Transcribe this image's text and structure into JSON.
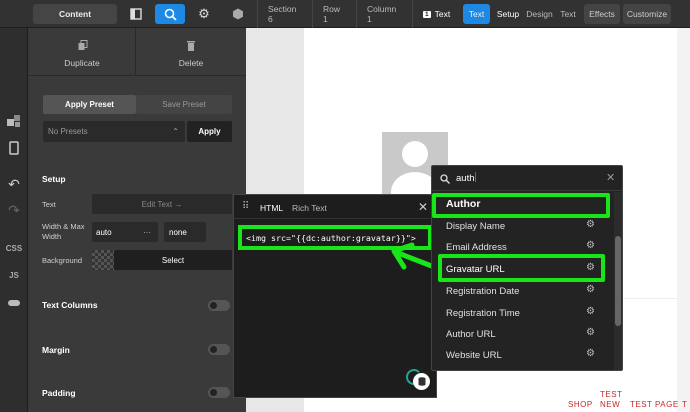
{
  "toolbar": {
    "content_label": "Content",
    "breadcrumbs": [
      "Section 6",
      "Row 1",
      "Column 1",
      "Text"
    ],
    "breadcrumb_badge": "1",
    "text_tab": "Text",
    "setup_tab": "Setup",
    "design_tab": "Design",
    "text_tab2": "Text",
    "effects_label": "Effects",
    "customize_label": "Customize"
  },
  "rail": {
    "css": "CSS",
    "js": "JS"
  },
  "panel": {
    "duplicate": "Duplicate",
    "delete": "Delete",
    "apply_preset": "Apply Preset",
    "save_preset": "Save Preset",
    "presets_placeholder": "No Presets",
    "apply": "Apply",
    "setup_heading": "Setup",
    "text_label": "Text",
    "edit_text": "Edit Text →",
    "width_label": "Width & Max Width",
    "width_value": "auto",
    "max_width_value": "none",
    "background_label": "Background",
    "select_label": "Select",
    "text_columns": "Text Columns",
    "margin": "Margin",
    "padding": "Padding"
  },
  "editor": {
    "tab_html": "HTML",
    "tab_rich": "Rich Text",
    "code": "<img src=\"{{dc:author:gravatar}}\">"
  },
  "dropdown": {
    "search_value": "auth",
    "group_label": "Author",
    "items": [
      "Display Name",
      "Email Address",
      "Gravatar URL",
      "Registration Date",
      "Registration Time",
      "Author URL",
      "Website URL"
    ]
  },
  "nav": {
    "shop": "SHOP",
    "test_new": [
      "TEST",
      "NEW"
    ],
    "test_page": "TEST PAGE",
    "t": "T"
  },
  "colors": {
    "accent": "#1e88e5",
    "highlight": "#19e619",
    "nav_red": "#c62828"
  }
}
